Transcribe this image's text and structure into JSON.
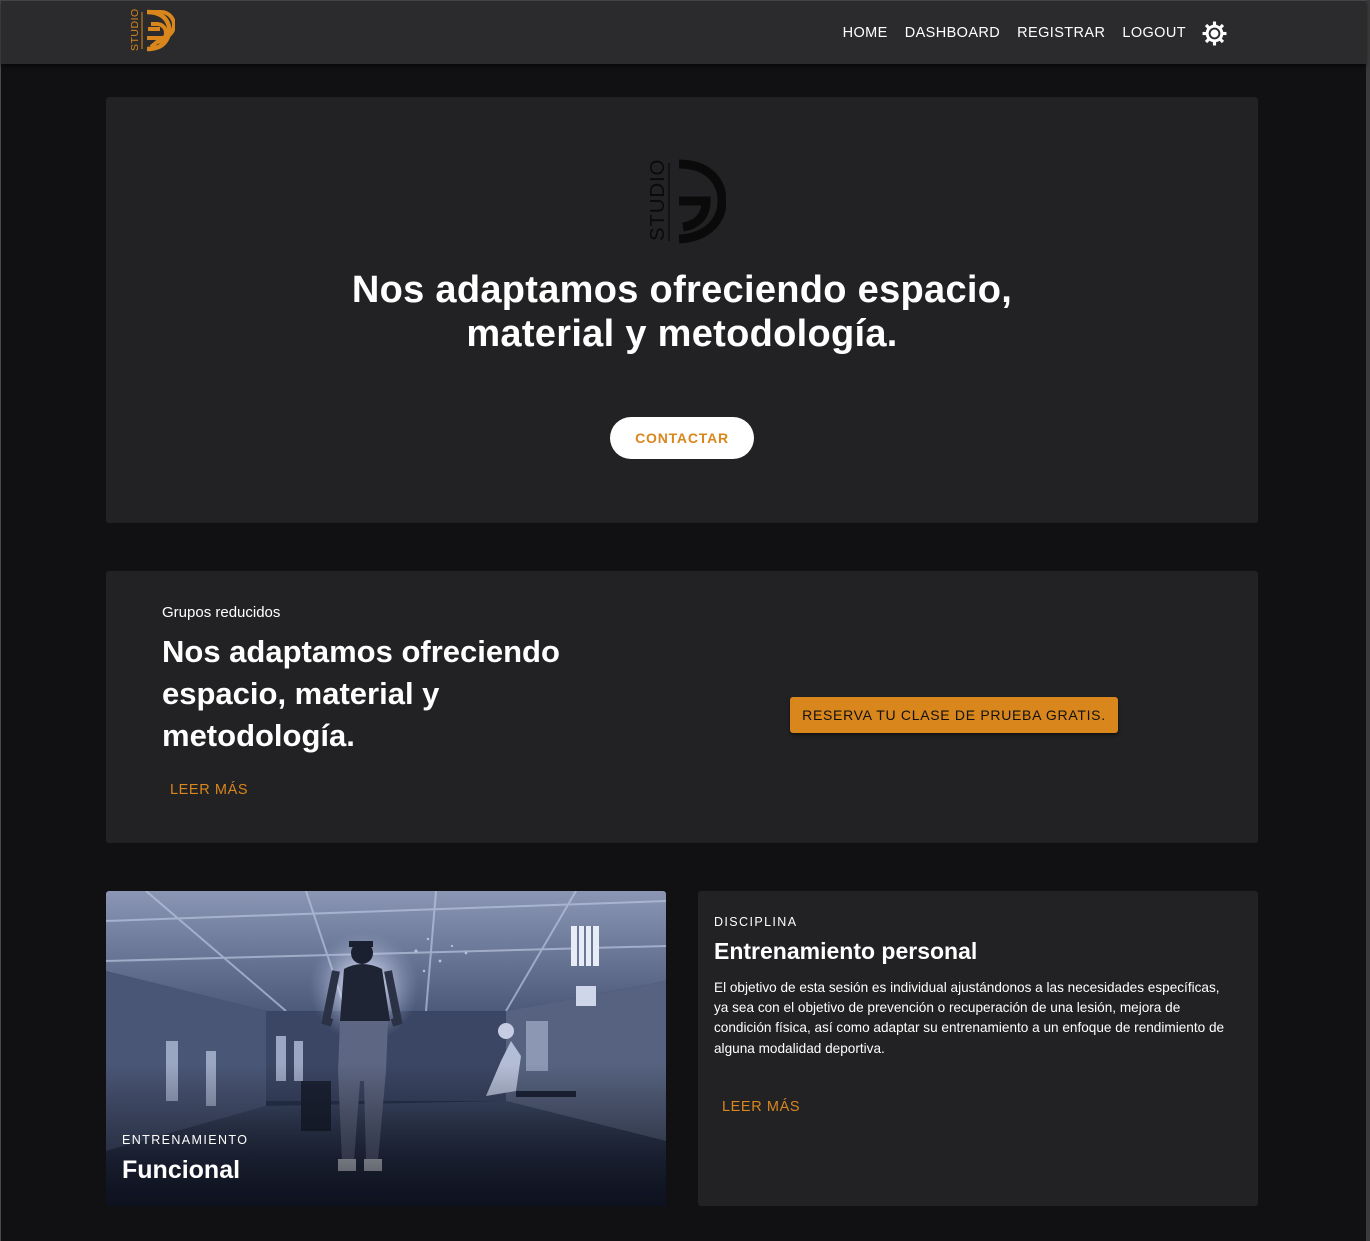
{
  "colors": {
    "accent": "#d9861c",
    "navbar_bg": "#2b2b2d",
    "card_bg": "#222224",
    "page_bg": "#111113"
  },
  "navbar": {
    "logo_text": "STUDIO",
    "links": [
      "HOME",
      "DASHBOARD",
      "REGISTRAR",
      "LOGOUT"
    ],
    "theme_toggle_icon": "sun-icon"
  },
  "hero": {
    "logo_text": "STUDIO",
    "title_line1": "Nos adaptamos ofreciendo espacio,",
    "title_line2": "material y metodología.",
    "contact_label": "CONTACTAR"
  },
  "groups": {
    "overline": "Grupos reducidos",
    "title": "Nos adaptamos ofreciendo espacio, material y metodología.",
    "read_more": "LEER MÁS",
    "reserve_label": "RESERVA TU CLASE DE PRUEBA GRATIS."
  },
  "training_card": {
    "overline": "ENTRENAMIENTO",
    "title": "Funcional"
  },
  "personal_card": {
    "overline": "DISCIPLINA",
    "title": "Entrenamiento personal",
    "body": "El objetivo de esta sesión es individual ajustándonos a las necesidades específicas, ya sea con el objetivo de prevención o recuperación de una lesión, mejora de condición física, así como adaptar su entrenamiento a un enfoque de rendimiento de alguna modalidad deportiva.",
    "read_more": "LEER MÁS"
  }
}
